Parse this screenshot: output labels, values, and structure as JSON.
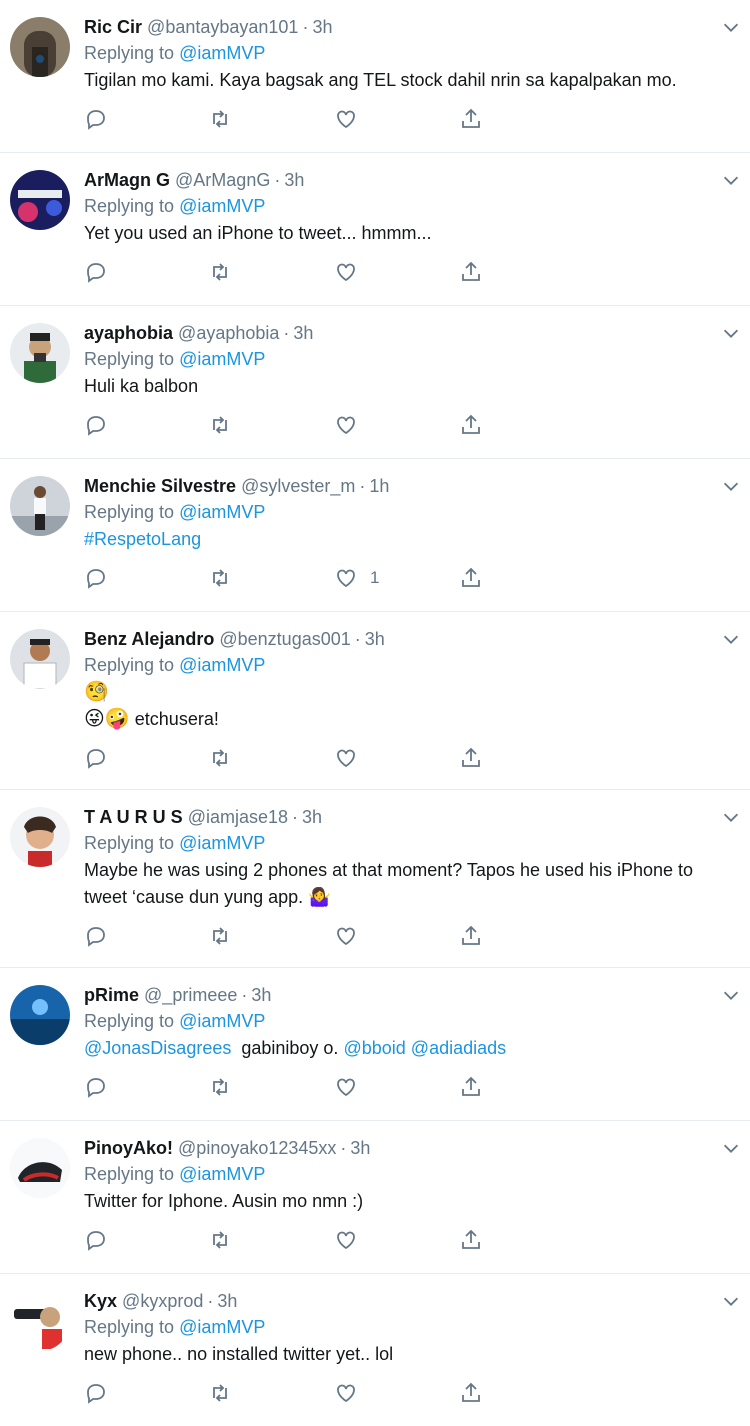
{
  "colors": {
    "link": "#1b95e0",
    "muted": "#657786",
    "text": "#14171a",
    "divider": "#e6ecf0"
  },
  "icons": {
    "reply": "reply-icon",
    "retweet": "retweet-icon",
    "like": "like-icon",
    "share": "share-icon",
    "more": "chevron-down-icon"
  },
  "replying_label": "Replying to",
  "mention": "@iamMVP",
  "tweets": [
    {
      "name": "Ric Cir",
      "handle": "@bantaybayan101",
      "sep": "·",
      "time": "3h",
      "text": "Tigilan mo kami. Kaya bagsak ang TEL stock dahil nrin sa kapalpakan mo.",
      "likes": ""
    },
    {
      "name": "ArMagn G",
      "handle": "@ArMagnG",
      "sep": "·",
      "time": "3h",
      "text": "Yet you used an iPhone to tweet... hmmm...",
      "likes": ""
    },
    {
      "name": "ayaphobia",
      "handle": "@ayaphobia",
      "sep": "·",
      "time": "3h",
      "text": "Huli ka balbon",
      "likes": ""
    },
    {
      "name": "Menchie Silvestre",
      "handle": "@sylvester_m",
      "sep": "·",
      "time": "1h",
      "hashtag": "#RespetoLang",
      "likes": "1"
    },
    {
      "name": "Benz Alejandro",
      "handle": "@benztugas001",
      "sep": "·",
      "time": "3h",
      "emoji1": "🧐",
      "emoji2": "😜🤪",
      "text": "etchusera!",
      "likes": ""
    },
    {
      "name": "T A U R U S",
      "handle": "@iamjase18",
      "sep": "·",
      "time": "3h",
      "text": "Maybe he was using 2 phones at that moment? Tapos he used his iPhone to tweet ‘cause dun yung app.",
      "emoji": "🤷‍♀️",
      "likes": ""
    },
    {
      "name": "pRime",
      "handle": "@_primeee",
      "sep": "·",
      "time": "3h",
      "m1": "@JonasDisagrees",
      "text": "gabiniboy o.",
      "m2": "@bboid",
      "m3": "@adiadiads",
      "likes": ""
    },
    {
      "name": "PinoyAko!",
      "handle": "@pinoyako12345xx",
      "sep": "·",
      "time": "3h",
      "text": "Twitter for Iphone. Ausin mo nmn :)",
      "likes": ""
    },
    {
      "name": "Kyx",
      "handle": "@kyxprod",
      "sep": "·",
      "time": "3h",
      "text": "new phone.. no installed twitter yet.. lol",
      "likes": ""
    }
  ]
}
